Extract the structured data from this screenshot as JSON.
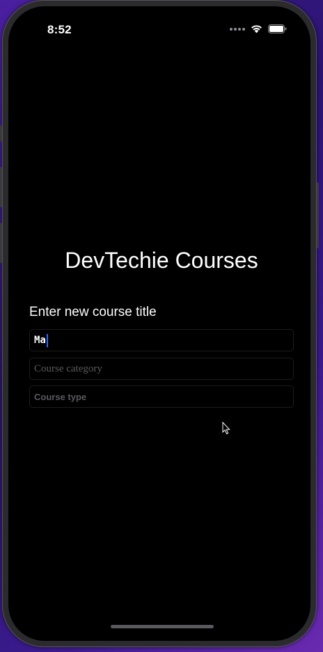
{
  "status_bar": {
    "time": "8:52",
    "icons": [
      "signal-dots-icon",
      "wifi-icon",
      "battery-icon"
    ]
  },
  "app": {
    "title": "DevTechie Courses",
    "section_label": "Enter new course title"
  },
  "form": {
    "title_field": {
      "value": "Ma",
      "placeholder": ""
    },
    "category_field": {
      "value": "",
      "placeholder": "Course category"
    },
    "type_field": {
      "value": "",
      "placeholder": "Course type"
    }
  },
  "colors": {
    "background": "#000000",
    "text": "#ffffff",
    "placeholder": "#5a5a5e",
    "caret": "#2f6bff",
    "field_border": "#1c1c1e"
  }
}
